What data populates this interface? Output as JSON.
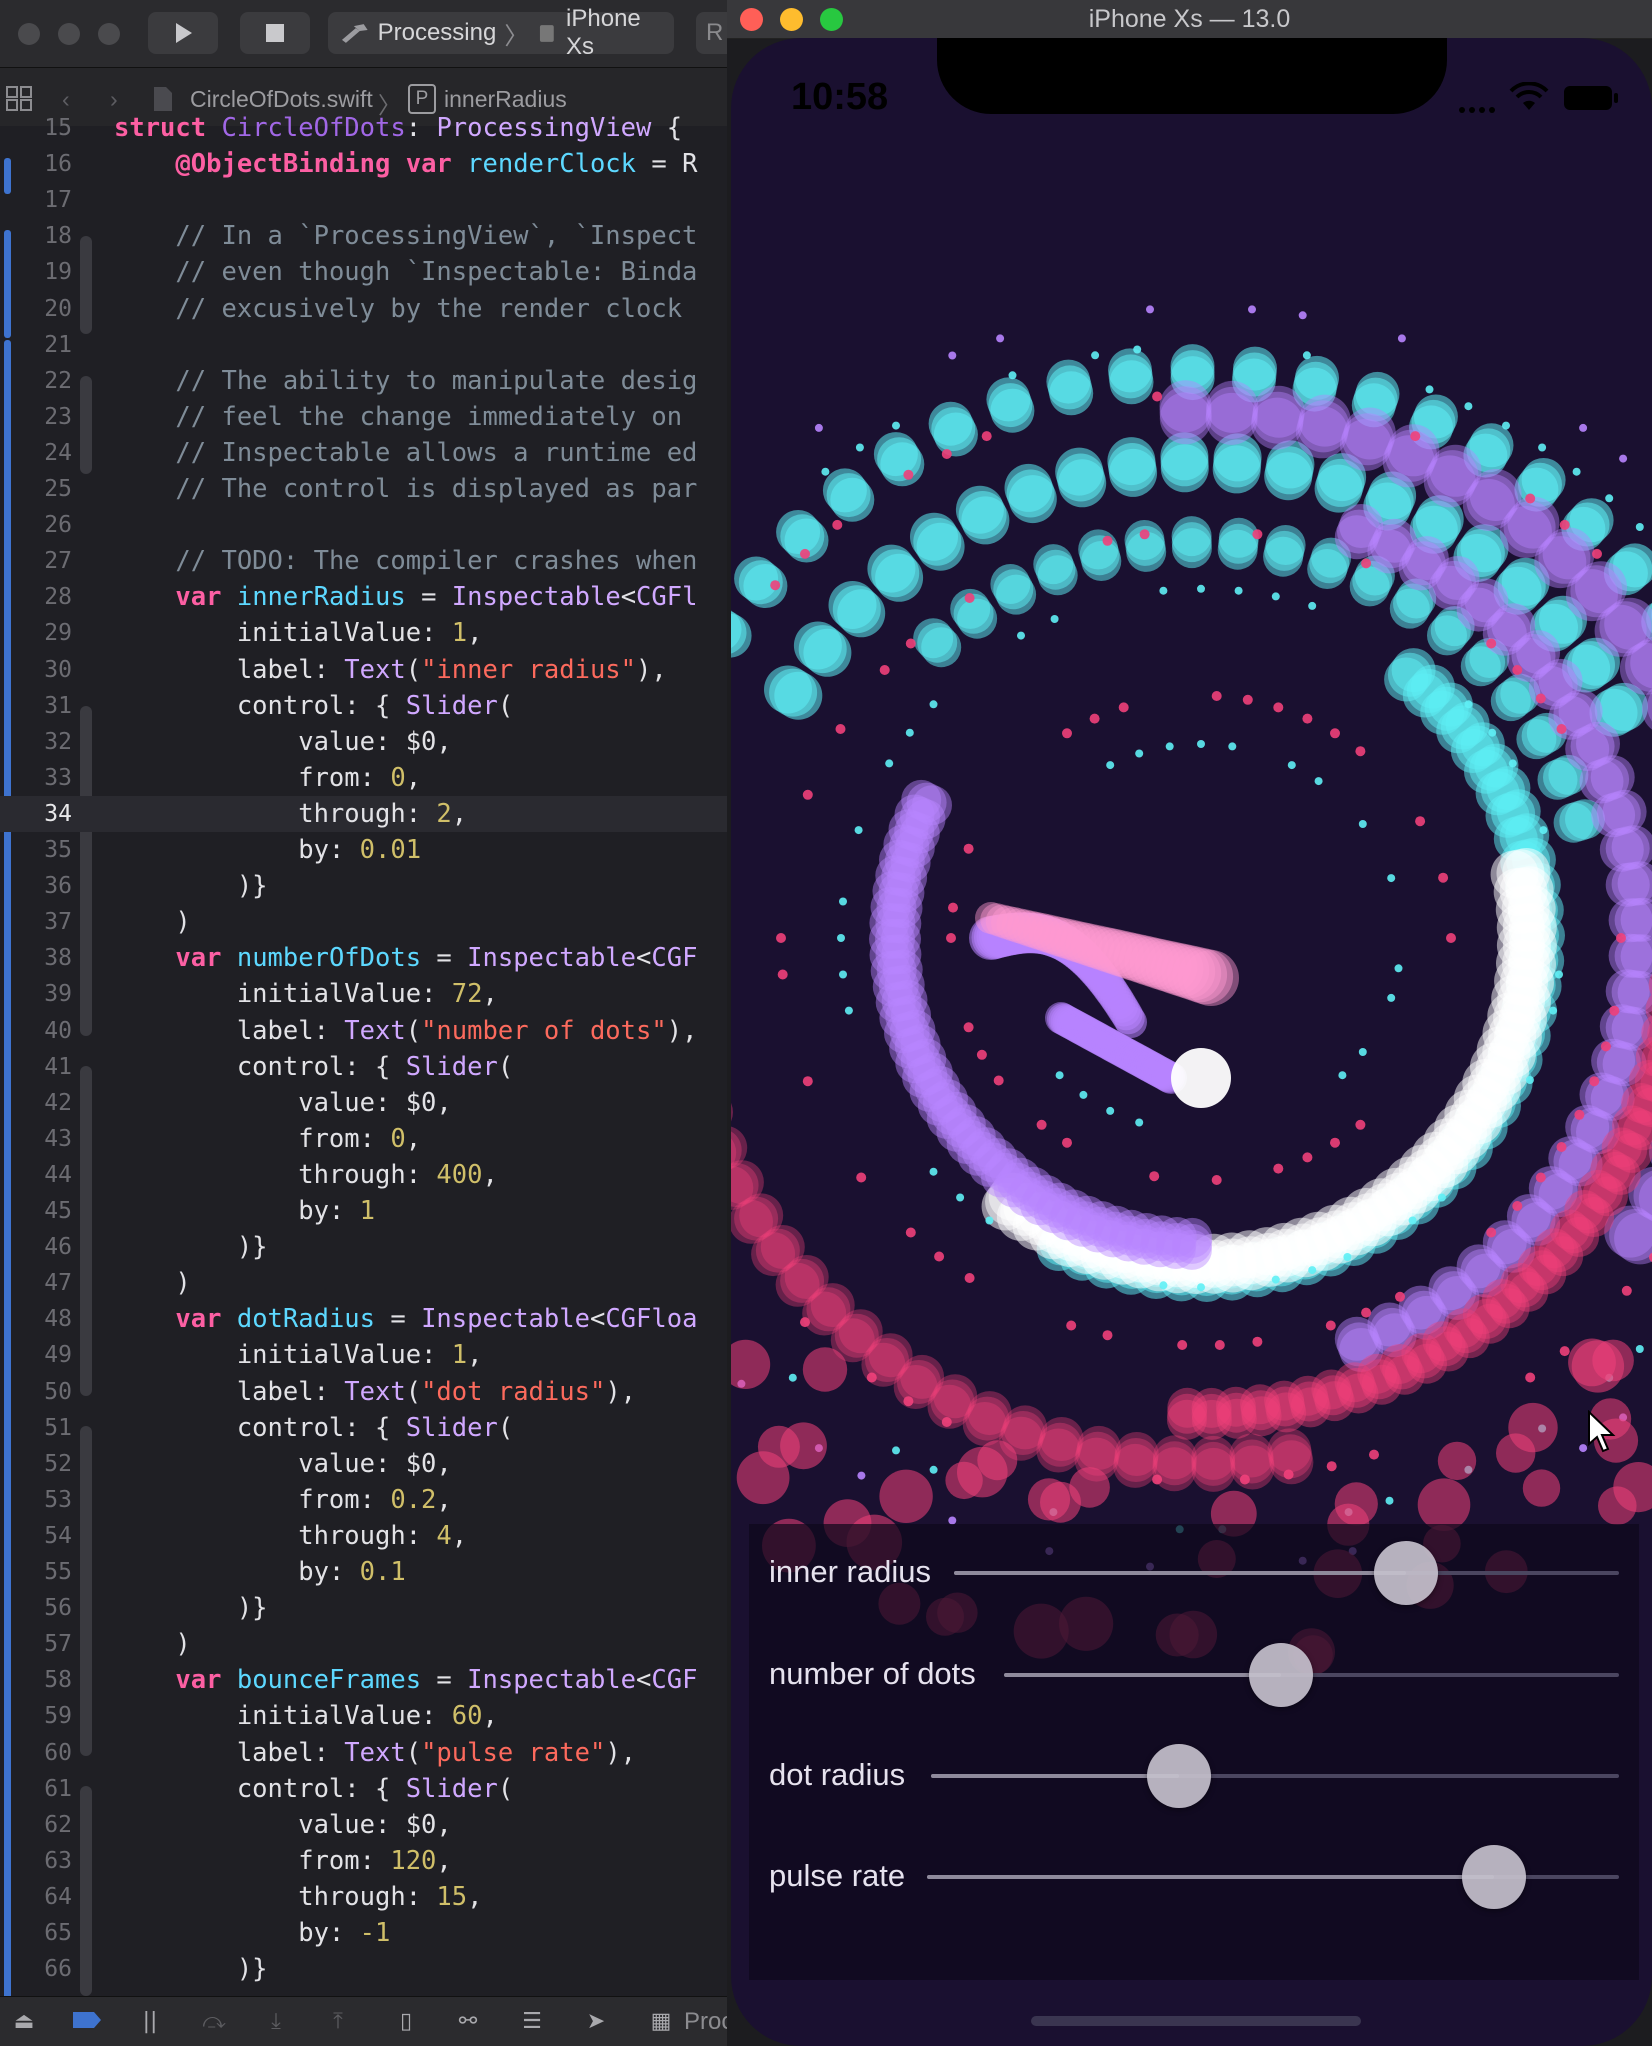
{
  "xcode": {
    "toolbar": {
      "scheme": "Processing",
      "destination": "iPhone Xs",
      "overflow": "R",
      "run_icon": "play-icon",
      "stop_icon": "stop-icon"
    },
    "jumpbar": {
      "file": "CircleOfDots.swift",
      "symbol_badge": "P",
      "symbol": "innerRadius"
    },
    "current_line": 34,
    "lines": [
      {
        "n": "15",
        "t": [
          [
            "kw",
            "struct"
          ],
          [
            "pl",
            " "
          ],
          [
            "tyb",
            "CircleOfDots"
          ],
          [
            "pl",
            ": "
          ],
          [
            "ty",
            "ProcessingView"
          ],
          [
            "pl",
            " {"
          ]
        ]
      },
      {
        "n": "16",
        "t": [
          [
            "pl",
            "    "
          ],
          [
            "kw",
            "@ObjectBinding"
          ],
          [
            "pl",
            " "
          ],
          [
            "kw",
            "var"
          ],
          [
            "pl",
            " "
          ],
          [
            "id",
            "renderClock"
          ],
          [
            "pl",
            " = R"
          ]
        ]
      },
      {
        "n": "17",
        "t": []
      },
      {
        "n": "18",
        "t": [
          [
            "pl",
            "    "
          ],
          [
            "cm",
            "// In a `ProcessingView`, `Inspect"
          ]
        ]
      },
      {
        "n": "19",
        "t": [
          [
            "pl",
            "    "
          ],
          [
            "cm",
            "// even though `Inspectable: Binda"
          ]
        ]
      },
      {
        "n": "20",
        "t": [
          [
            "pl",
            "    "
          ],
          [
            "cm",
            "// excusively by the render clock "
          ]
        ]
      },
      {
        "n": "21",
        "t": []
      },
      {
        "n": "22",
        "t": [
          [
            "pl",
            "    "
          ],
          [
            "cm",
            "// The ability to manipulate desig"
          ]
        ]
      },
      {
        "n": "23",
        "t": [
          [
            "pl",
            "    "
          ],
          [
            "cm",
            "// feel the change immediately on "
          ]
        ]
      },
      {
        "n": "24",
        "t": [
          [
            "pl",
            "    "
          ],
          [
            "cm",
            "// Inspectable allows a runtime ed"
          ]
        ]
      },
      {
        "n": "25",
        "t": [
          [
            "pl",
            "    "
          ],
          [
            "cm",
            "// The control is displayed as par"
          ]
        ]
      },
      {
        "n": "26",
        "t": []
      },
      {
        "n": "27",
        "t": [
          [
            "pl",
            "    "
          ],
          [
            "cm",
            "// TODO: The compiler crashes when"
          ]
        ]
      },
      {
        "n": "28",
        "t": [
          [
            "pl",
            "    "
          ],
          [
            "kw",
            "var"
          ],
          [
            "pl",
            " "
          ],
          [
            "id",
            "innerRadius"
          ],
          [
            "pl",
            " = "
          ],
          [
            "ty",
            "Inspectable"
          ],
          [
            "pl",
            "<"
          ],
          [
            "ty",
            "CGFl"
          ]
        ]
      },
      {
        "n": "29",
        "t": [
          [
            "pl",
            "        initialValue: "
          ],
          [
            "num",
            "1"
          ],
          [
            "pl",
            ","
          ]
        ]
      },
      {
        "n": "30",
        "t": [
          [
            "pl",
            "        label: "
          ],
          [
            "ty",
            "Text"
          ],
          [
            "pl",
            "("
          ],
          [
            "str",
            "\"inner radius\""
          ],
          [
            "pl",
            "),"
          ]
        ]
      },
      {
        "n": "31",
        "t": [
          [
            "pl",
            "        control: { "
          ],
          [
            "ty",
            "Slider"
          ],
          [
            "pl",
            "("
          ]
        ]
      },
      {
        "n": "32",
        "t": [
          [
            "pl",
            "            value: $0,"
          ]
        ]
      },
      {
        "n": "33",
        "t": [
          [
            "pl",
            "            from: "
          ],
          [
            "num",
            "0"
          ],
          [
            "pl",
            ","
          ]
        ]
      },
      {
        "n": "34",
        "t": [
          [
            "pl",
            "            through: "
          ],
          [
            "num",
            "2"
          ],
          [
            "pl",
            ","
          ]
        ]
      },
      {
        "n": "35",
        "t": [
          [
            "pl",
            "            by: "
          ],
          [
            "num",
            "0.01"
          ]
        ]
      },
      {
        "n": "36",
        "t": [
          [
            "pl",
            "        )}"
          ]
        ]
      },
      {
        "n": "37",
        "t": [
          [
            "pl",
            "    )"
          ]
        ]
      },
      {
        "n": "38",
        "t": [
          [
            "pl",
            "    "
          ],
          [
            "kw",
            "var"
          ],
          [
            "pl",
            " "
          ],
          [
            "id",
            "numberOfDots"
          ],
          [
            "pl",
            " = "
          ],
          [
            "ty",
            "Inspectable"
          ],
          [
            "pl",
            "<"
          ],
          [
            "ty",
            "CGF"
          ]
        ]
      },
      {
        "n": "39",
        "t": [
          [
            "pl",
            "        initialValue: "
          ],
          [
            "num",
            "72"
          ],
          [
            "pl",
            ","
          ]
        ]
      },
      {
        "n": "40",
        "t": [
          [
            "pl",
            "        label: "
          ],
          [
            "ty",
            "Text"
          ],
          [
            "pl",
            "("
          ],
          [
            "str",
            "\"number of dots\""
          ],
          [
            "pl",
            "),"
          ]
        ]
      },
      {
        "n": "41",
        "t": [
          [
            "pl",
            "        control: { "
          ],
          [
            "ty",
            "Slider"
          ],
          [
            "pl",
            "("
          ]
        ]
      },
      {
        "n": "42",
        "t": [
          [
            "pl",
            "            value: $0,"
          ]
        ]
      },
      {
        "n": "43",
        "t": [
          [
            "pl",
            "            from: "
          ],
          [
            "num",
            "0"
          ],
          [
            "pl",
            ","
          ]
        ]
      },
      {
        "n": "44",
        "t": [
          [
            "pl",
            "            through: "
          ],
          [
            "num",
            "400"
          ],
          [
            "pl",
            ","
          ]
        ]
      },
      {
        "n": "45",
        "t": [
          [
            "pl",
            "            by: "
          ],
          [
            "num",
            "1"
          ]
        ]
      },
      {
        "n": "46",
        "t": [
          [
            "pl",
            "        )}"
          ]
        ]
      },
      {
        "n": "47",
        "t": [
          [
            "pl",
            "    )"
          ]
        ]
      },
      {
        "n": "48",
        "t": [
          [
            "pl",
            "    "
          ],
          [
            "kw",
            "var"
          ],
          [
            "pl",
            " "
          ],
          [
            "id",
            "dotRadius"
          ],
          [
            "pl",
            " = "
          ],
          [
            "ty",
            "Inspectable"
          ],
          [
            "pl",
            "<"
          ],
          [
            "ty",
            "CGFloa"
          ]
        ]
      },
      {
        "n": "49",
        "t": [
          [
            "pl",
            "        initialValue: "
          ],
          [
            "num",
            "1"
          ],
          [
            "pl",
            ","
          ]
        ]
      },
      {
        "n": "50",
        "t": [
          [
            "pl",
            "        label: "
          ],
          [
            "ty",
            "Text"
          ],
          [
            "pl",
            "("
          ],
          [
            "str",
            "\"dot radius\""
          ],
          [
            "pl",
            "),"
          ]
        ]
      },
      {
        "n": "51",
        "t": [
          [
            "pl",
            "        control: { "
          ],
          [
            "ty",
            "Slider"
          ],
          [
            "pl",
            "("
          ]
        ]
      },
      {
        "n": "52",
        "t": [
          [
            "pl",
            "            value: $0,"
          ]
        ]
      },
      {
        "n": "53",
        "t": [
          [
            "pl",
            "            from: "
          ],
          [
            "num",
            "0.2"
          ],
          [
            "pl",
            ","
          ]
        ]
      },
      {
        "n": "54",
        "t": [
          [
            "pl",
            "            through: "
          ],
          [
            "num",
            "4"
          ],
          [
            "pl",
            ","
          ]
        ]
      },
      {
        "n": "55",
        "t": [
          [
            "pl",
            "            by: "
          ],
          [
            "num",
            "0.1"
          ]
        ]
      },
      {
        "n": "56",
        "t": [
          [
            "pl",
            "        )}"
          ]
        ]
      },
      {
        "n": "57",
        "t": [
          [
            "pl",
            "    )"
          ]
        ]
      },
      {
        "n": "58",
        "t": [
          [
            "pl",
            "    "
          ],
          [
            "kw",
            "var"
          ],
          [
            "pl",
            " "
          ],
          [
            "id",
            "bounceFrames"
          ],
          [
            "pl",
            " = "
          ],
          [
            "ty",
            "Inspectable"
          ],
          [
            "pl",
            "<"
          ],
          [
            "ty",
            "CGF"
          ]
        ]
      },
      {
        "n": "59",
        "t": [
          [
            "pl",
            "        initialValue: "
          ],
          [
            "num",
            "60"
          ],
          [
            "pl",
            ","
          ]
        ]
      },
      {
        "n": "60",
        "t": [
          [
            "pl",
            "        label: "
          ],
          [
            "ty",
            "Text"
          ],
          [
            "pl",
            "("
          ],
          [
            "str",
            "\"pulse rate\""
          ],
          [
            "pl",
            "),"
          ]
        ]
      },
      {
        "n": "61",
        "t": [
          [
            "pl",
            "        control: { "
          ],
          [
            "ty",
            "Slider"
          ],
          [
            "pl",
            "("
          ]
        ]
      },
      {
        "n": "62",
        "t": [
          [
            "pl",
            "            value: $0,"
          ]
        ]
      },
      {
        "n": "63",
        "t": [
          [
            "pl",
            "            from: "
          ],
          [
            "num",
            "120"
          ],
          [
            "pl",
            ","
          ]
        ]
      },
      {
        "n": "64",
        "t": [
          [
            "pl",
            "            through: "
          ],
          [
            "num",
            "15"
          ],
          [
            "pl",
            ","
          ]
        ]
      },
      {
        "n": "65",
        "t": [
          [
            "pl",
            "            by: "
          ],
          [
            "num",
            "-1"
          ]
        ]
      },
      {
        "n": "66",
        "t": [
          [
            "pl",
            "        )}"
          ]
        ]
      }
    ],
    "debugbar": {
      "process_label": "Proc"
    },
    "colors": {
      "keyword": "#fc5fa3",
      "type": "#d0a8ff",
      "identifier": "#5dd8ff",
      "comment": "#7f8c98",
      "string": "#fc6a5d",
      "number": "#d0bf69",
      "change_bar": "#3e73cf"
    }
  },
  "simulator": {
    "title": "iPhone Xs — 13.0",
    "status_time": "10:58",
    "sliders": [
      {
        "label": "inner radius",
        "fraction": 0.68
      },
      {
        "label": "number of dots",
        "fraction": 0.45
      },
      {
        "label": "dot radius",
        "fraction": 0.36
      },
      {
        "label": "pulse rate",
        "fraction": 0.82
      }
    ],
    "colors": {
      "background": "#1a1030",
      "cyan": "#5ff0f5",
      "violet": "#b884ff",
      "pink": "#f0407a",
      "white": "#ffffff"
    }
  }
}
